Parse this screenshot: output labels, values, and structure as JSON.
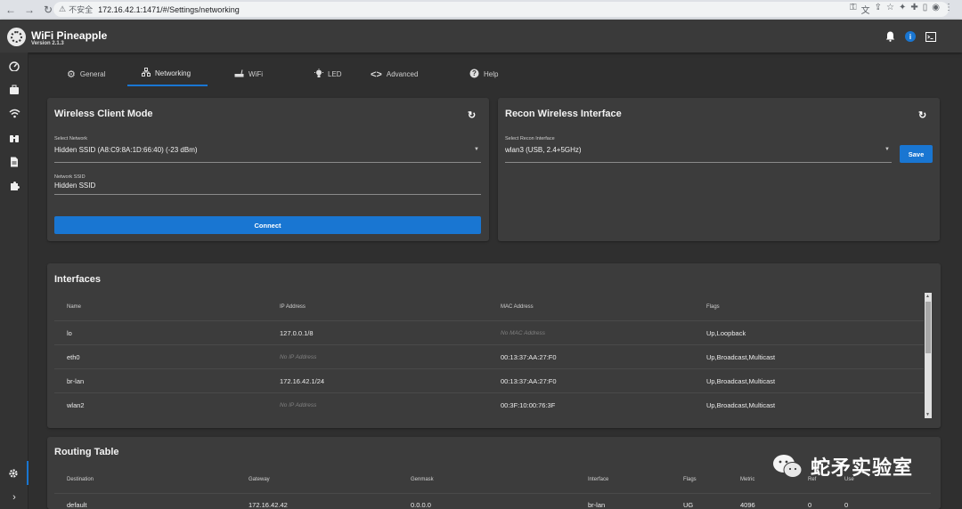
{
  "browser": {
    "security_label": "不安全",
    "url": "172.16.42.1:1471/#/Settings/networking"
  },
  "header": {
    "title": "WiFi Pineapple",
    "version": "Version 2.1.3"
  },
  "tabs": [
    {
      "label": "General",
      "icon": "gear-icon"
    },
    {
      "label": "Networking",
      "icon": "network-icon"
    },
    {
      "label": "WiFi",
      "icon": "router-icon"
    },
    {
      "label": "LED",
      "icon": "lightbulb-icon"
    },
    {
      "label": "Advanced",
      "icon": "code-icon"
    },
    {
      "label": "Help",
      "icon": "help-icon"
    }
  ],
  "client_mode": {
    "title": "Wireless Client Mode",
    "network_label": "Select Network",
    "network_value": "Hidden SSID (A8:C9:8A:1D:66:40) (-23 dBm)",
    "ssid_label": "Network SSID",
    "ssid_value": "Hidden SSID",
    "connect_label": "Connect"
  },
  "recon": {
    "title": "Recon Wireless Interface",
    "interface_label": "Select Recon Interface",
    "interface_value": "wlan3 (USB, 2.4+5GHz)",
    "save_label": "Save"
  },
  "interfaces": {
    "title": "Interfaces",
    "columns": [
      "Name",
      "IP Address",
      "MAC Address",
      "Flags"
    ],
    "rows": [
      {
        "name": "lo",
        "ip": "127.0.0.1/8",
        "mac": "No MAC Address",
        "flags": "Up,Loopback"
      },
      {
        "name": "eth0",
        "ip": "No IP Address",
        "mac": "00:13:37:AA:27:F0",
        "flags": "Up,Broadcast,Multicast"
      },
      {
        "name": "br-lan",
        "ip": "172.16.42.1/24",
        "mac": "00:13:37:AA:27:F0",
        "flags": "Up,Broadcast,Multicast"
      },
      {
        "name": "wlan2",
        "ip": "No IP Address",
        "mac": "00:3F:10:00:76:3F",
        "flags": "Up,Broadcast,Multicast"
      }
    ]
  },
  "routing": {
    "title": "Routing Table",
    "columns": [
      "Destination",
      "Gateway",
      "Genmask",
      "Interface",
      "Flags",
      "Metric",
      "Ref",
      "Use"
    ],
    "rows": [
      {
        "destination": "default",
        "gateway": "172.16.42.42",
        "genmask": "0.0.0.0",
        "interface": "br-lan",
        "flags": "UG",
        "metric": "4096",
        "ref": "0",
        "use": "0"
      }
    ]
  },
  "watermark": {
    "text": "蛇矛实验室"
  },
  "colors": {
    "accent": "#1976d2",
    "background": "#2f2f2f",
    "card": "#3c3c3c"
  }
}
